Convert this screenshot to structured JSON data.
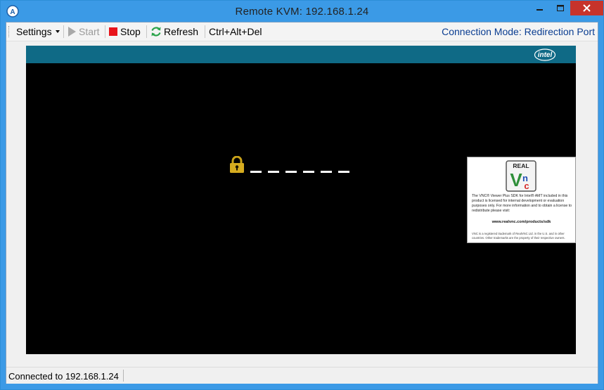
{
  "window": {
    "title": "Remote KVM: 192.168.1.24",
    "colors": {
      "frame": "#3b9ae6",
      "close": "#c7332b"
    }
  },
  "toolbar": {
    "settings_label": "Settings",
    "start_label": "Start",
    "stop_label": "Stop",
    "refresh_label": "Refresh",
    "cad_label": "Ctrl+Alt+Del",
    "connection_mode": "Connection Mode: Redirection Port"
  },
  "remote_screen": {
    "header_color": "#0f6a86",
    "intel_logo_text": "intel",
    "lock_icon": "padlock-icon",
    "password_mask_count": 6,
    "vnc_notice": {
      "logo_text": "REAL VNC",
      "body": "The VNC® Viewer Plus SDK for Intel® AMT included in this product is licensed for internal development or evaluation purposes only. For more information and to obtain a license to redistribute please visit:",
      "url": "www.realvnc.com/products/sdk",
      "trademark": "VNC is a registered trademark of RealVNC Ltd. in the U.S. and in other countries. Other trademarks are the property of their respective owners."
    }
  },
  "statusbar": {
    "text": "Connected to 192.168.1.24"
  }
}
